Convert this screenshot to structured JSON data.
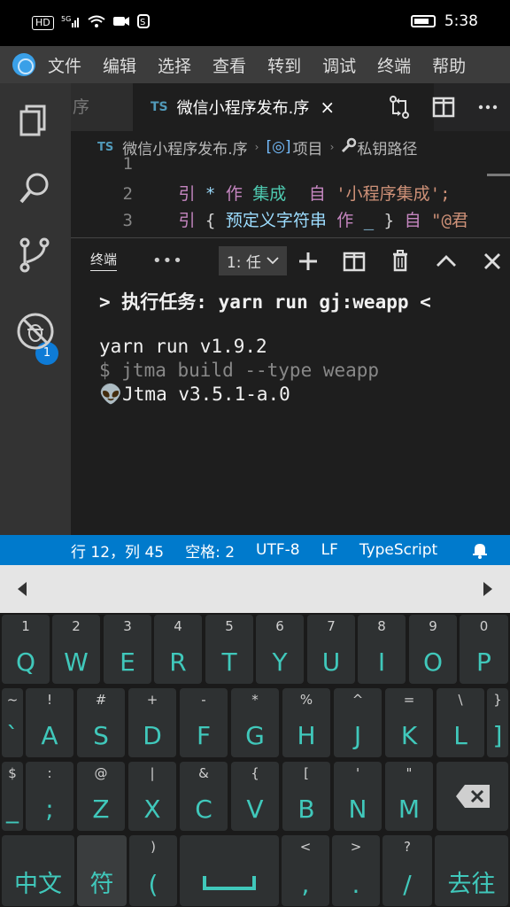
{
  "status_bar": {
    "time": "5:38",
    "net_badge": "HD",
    "signal": "5G"
  },
  "menu": {
    "items": [
      "文件",
      "编辑",
      "选择",
      "查看",
      "转到",
      "调试",
      "终端",
      "帮助"
    ]
  },
  "activity": {
    "scm_badge": "1"
  },
  "tabs": {
    "inactive_label": "序",
    "active_lang": "TS",
    "active_title": "微信小程序发布.序",
    "close_glyph": "×"
  },
  "breadcrumb": {
    "lang": "TS",
    "file": "微信小程序发布.序",
    "item1": "项目",
    "item2": "私钥路径",
    "sep": "›",
    "sym1": "[◎]"
  },
  "editor": {
    "lines": [
      {
        "num": "1",
        "tokens": []
      },
      {
        "num": "2",
        "t1": "引",
        "t2": "*",
        "t3": "作",
        "t4": "集成",
        "t5": "自",
        "t6": "'小程序集成';"
      },
      {
        "num": "3",
        "t1": "引",
        "t2": "{",
        "t3": "预定义字符串",
        "t4": "作",
        "t5": "_",
        "t6": "}",
        "t7": "自",
        "t8": "\"@君"
      }
    ]
  },
  "panel": {
    "title": "终端",
    "more": "•••",
    "terminal_selected": "1: 任",
    "lines": [
      "> 执行任务:  yarn run gj:weapp <",
      "",
      "yarn run v1.9.2",
      "$ jtma build --type weapp",
      "👽Jtma v3.5.1-a.0"
    ]
  },
  "vs_status": {
    "position": "行 12，列 45",
    "spaces": "空格: 2",
    "encoding": "UTF-8",
    "eol": "LF",
    "language": "TypeScript"
  },
  "keyboard": {
    "row1": [
      {
        "sub": "1",
        "main": "Q"
      },
      {
        "sub": "2",
        "main": "W"
      },
      {
        "sub": "3",
        "main": "E"
      },
      {
        "sub": "4",
        "main": "R"
      },
      {
        "sub": "5",
        "main": "T"
      },
      {
        "sub": "6",
        "main": "Y"
      },
      {
        "sub": "7",
        "main": "U"
      },
      {
        "sub": "8",
        "main": "I"
      },
      {
        "sub": "9",
        "main": "O"
      },
      {
        "sub": "0",
        "main": "P"
      }
    ],
    "row2": [
      {
        "sub": "~",
        "main": "`"
      },
      {
        "sub": "!",
        "main": "A"
      },
      {
        "sub": "#",
        "main": "S"
      },
      {
        "sub": "+",
        "main": "D"
      },
      {
        "sub": "-",
        "main": "F"
      },
      {
        "sub": "*",
        "main": "G"
      },
      {
        "sub": "%",
        "main": "H"
      },
      {
        "sub": "^",
        "main": "J"
      },
      {
        "sub": "=",
        "main": "K"
      },
      {
        "sub": "\\",
        "main": "L"
      },
      {
        "sub": "}",
        "main": "]"
      }
    ],
    "row3": [
      {
        "sub": "$",
        "main": "_"
      },
      {
        "sub": ":",
        "main": ";"
      },
      {
        "sub": "@",
        "main": "Z"
      },
      {
        "sub": "|",
        "main": "X"
      },
      {
        "sub": "&",
        "main": "C"
      },
      {
        "sub": "{",
        "main": "V"
      },
      {
        "sub": "[",
        "main": "B"
      },
      {
        "sub": "'",
        "main": "N"
      },
      {
        "sub": "\"",
        "main": "M"
      }
    ],
    "row4": {
      "lang": "中文",
      "symbol": "符",
      "paren_sub": ")",
      "paren_main": "(",
      "lt_sub": "<",
      "comma": ",",
      "gt_sub": ">",
      "dot": ".",
      "q_sub": "?",
      "slash": "/",
      "go": "去往"
    }
  }
}
